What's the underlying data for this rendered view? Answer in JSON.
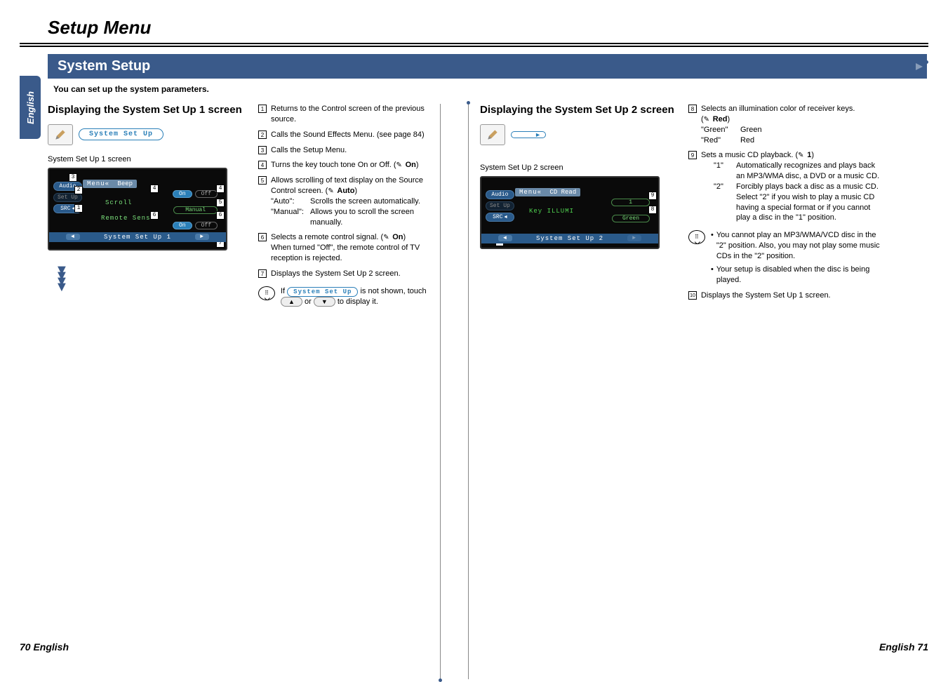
{
  "page_title": "Setup Menu",
  "english_tab": "English",
  "section_header": "System Setup",
  "intro": "You can set up the system parameters.",
  "left_col": {
    "subheading": "Displaying the System Set Up 1 screen",
    "btn_label": "System Set Up",
    "screen_label": "System Set Up 1 screen",
    "side_buttons": {
      "audio": "Audio",
      "setup": "Set Up",
      "src": "SRC"
    },
    "menu_bar": {
      "menu": "Menu«",
      "beep": "Beep"
    },
    "on": "On",
    "off": "Off",
    "scroll": "Scroll",
    "manual": "Manual",
    "remote_sensor": "Remote Sensor",
    "footer": "System Set Up 1"
  },
  "desc_left": {
    "1": "Returns to the Control screen of the previous source.",
    "2": "Calls the Sound Effects Menu. (see page 84)",
    "3": "Calls the Setup Menu.",
    "4": {
      "text": "Turns the key touch tone On or Off. (",
      "val": "On",
      "tail": ")"
    },
    "5": {
      "text": "Allows scrolling of text display on the Source Control screen. (",
      "val": "Auto",
      "tail": ")",
      "sub": [
        {
          "key": "\"Auto\":",
          "val": "Scrolls the screen automatically."
        },
        {
          "key": "\"Manual\":",
          "val": "Allows you to scroll the screen manually."
        }
      ]
    },
    "6": {
      "text": "Selects a remote control signal. (",
      "val": "On",
      "tail": ")",
      "note": "When turned \"Off\", the remote control of TV reception is rejected."
    },
    "7": "Displays the System Set Up 2 screen.",
    "tip": {
      "prefix": "If ",
      "button": "System Set Up",
      "mid": " is not shown, touch ",
      "up": "▲",
      "or": " or ",
      "down": "▼",
      "tail": " to display it."
    }
  },
  "right_col": {
    "subheading": "Displaying the System Set Up 2 screen",
    "screen_label": "System Set Up 2 screen",
    "side_buttons": {
      "audio": "Audio",
      "setup": "Set Up",
      "src": "SRC"
    },
    "menu_bar": {
      "menu": "Menu«",
      "cd_read": "CD Read"
    },
    "key_illumi": "Key ILLUMI",
    "val1": "1",
    "green": "Green",
    "footer": "System Set Up 2"
  },
  "desc_right": {
    "8": {
      "text": "Selects an illumination color of receiver keys.",
      "default": "Red",
      "rows": [
        {
          "k": "\"Green\"",
          "v": "Green"
        },
        {
          "k": "\"Red\"",
          "v": "Red"
        }
      ]
    },
    "9": {
      "text": "Sets a music CD playback. (",
      "val": "1",
      "tail": ")",
      "rows": [
        {
          "k": "\"1\"",
          "v": "Automatically recognizes and plays back an MP3/WMA disc, a DVD or a music CD."
        },
        {
          "k": "\"2\"",
          "v": "Forcibly plays back a disc as a music CD. Select \"2\" if you wish to play a music CD having a special format or if you cannot play a disc in the \"1\" position."
        }
      ],
      "warn": [
        "You cannot play an MP3/WMA/VCD disc in the \"2\" position.  Also, you may not play some music CDs in the \"2\" position.",
        "Your setup is disabled when the disc is being played."
      ]
    },
    "10": "Displays the System Set Up 1 screen."
  },
  "footer_left": "70 English",
  "footer_right": "English 71"
}
